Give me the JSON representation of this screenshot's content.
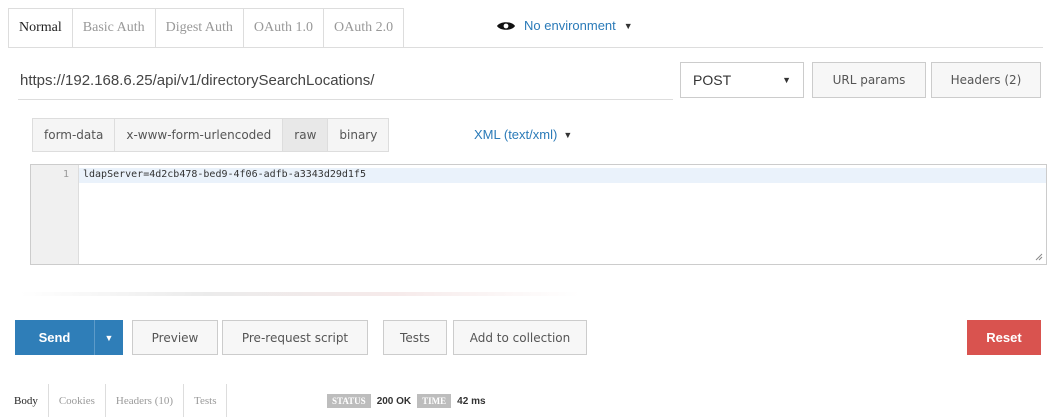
{
  "auth_tabs": [
    "Normal",
    "Basic Auth",
    "Digest Auth",
    "OAuth 1.0",
    "OAuth 2.0"
  ],
  "environment": {
    "label": "No environment",
    "icon": "eye-icon"
  },
  "request": {
    "url": "https://192.168.6.25/api/v1/directorySearchLocations/",
    "method": "POST",
    "url_params_label": "URL params",
    "headers_label": "Headers (2)"
  },
  "body_types": [
    "form-data",
    "x-www-form-urlencoded",
    "raw",
    "binary"
  ],
  "active_body_type": "raw",
  "content_type": "XML (text/xml)",
  "editor": {
    "line_number": "1",
    "code": "ldapServer=4d2cb478-bed9-4f06-adfb-a3343d29d1f5"
  },
  "actions": {
    "send": "Send",
    "preview": "Preview",
    "prerequest": "Pre-request script",
    "tests": "Tests",
    "add_to_collection": "Add to collection",
    "reset": "Reset"
  },
  "response": {
    "tabs": [
      "Body",
      "Cookies",
      "Headers (10)",
      "Tests"
    ],
    "status_label": "STATUS",
    "status_value": "200 OK",
    "time_label": "TIME",
    "time_value": "42 ms"
  },
  "colors": {
    "accent": "#2f7eb8",
    "danger": "#d9534f",
    "link": "#2a7ab8"
  }
}
